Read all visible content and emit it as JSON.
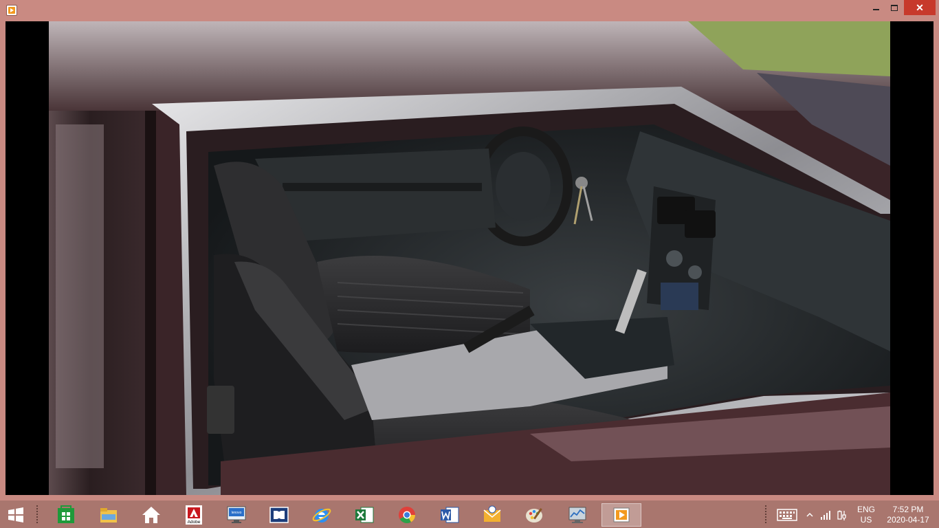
{
  "window": {
    "controls": {
      "minimize_icon": "minimize-icon",
      "maximize_icon": "maximize-icon",
      "close_icon": "close-icon",
      "close_glyph": "✕"
    },
    "app_icon": "media-player-icon"
  },
  "photo": {
    "subject": "car-interior-photo",
    "colors": {
      "car_paint": "#3a2428",
      "interior": "#262a2c",
      "chrome": "#b9b9bd",
      "grass": "#8fa35a"
    }
  },
  "taskbar": {
    "start_icon": "windows-start-icon",
    "pinned": [
      {
        "name": "store-icon",
        "color": "#1e9a3a"
      },
      {
        "name": "file-explorer-icon",
        "color": "#f0c24a"
      },
      {
        "name": "home-icon",
        "color": "#ffffff"
      },
      {
        "name": "adobe-icon",
        "color": "#c8171e",
        "label": "Adobe"
      },
      {
        "name": "lenovo-icon",
        "color": "#2a6fc9",
        "label": "lenovo"
      },
      {
        "name": "dolby-icon",
        "color": "#1c3d7a"
      },
      {
        "name": "internet-explorer-icon",
        "color": "#2d8ff0"
      },
      {
        "name": "excel-icon",
        "color": "#1e7a3c"
      },
      {
        "name": "chrome-icon",
        "color": "#e0403a"
      },
      {
        "name": "word-icon",
        "color": "#2b5aa8"
      },
      {
        "name": "outlook-icon",
        "color": "#f2b030"
      },
      {
        "name": "paint-icon",
        "color": "#7fb0e0"
      },
      {
        "name": "performance-monitor-icon",
        "color": "#c9d4dd"
      },
      {
        "name": "media-player-icon",
        "color": "#f39a1f",
        "active": true
      }
    ],
    "tray": {
      "keyboard_icon": "touch-keyboard-icon",
      "chevron_icon": "show-hidden-icons-icon",
      "signal_icon": "network-signal-icon",
      "power_icon": "power-icon",
      "lang_line1": "ENG",
      "lang_line2": "US",
      "time": "7:52 PM",
      "date": "2020-04-17"
    }
  }
}
